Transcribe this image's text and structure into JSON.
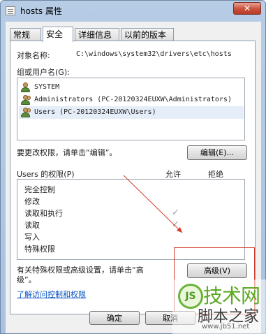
{
  "window": {
    "title": "hosts 属性",
    "close_label": "✕"
  },
  "tabs": [
    {
      "label": "常规",
      "active": false
    },
    {
      "label": "安全",
      "active": true
    },
    {
      "label": "详细信息",
      "active": false
    },
    {
      "label": "以前的版本",
      "active": false
    }
  ],
  "object": {
    "label": "对象名称:",
    "value": "C:\\windows\\system32\\drivers\\etc\\hosts"
  },
  "groups": {
    "label": "组或用户名(G):",
    "items": [
      {
        "name": "SYSTEM",
        "icon": "user-icon",
        "selected": false
      },
      {
        "name": "Administrators (PC-20120324EUXW\\Administrators)",
        "icon": "group-icon",
        "selected": false
      },
      {
        "name": "Users (PC-20120324EUXW\\Users)",
        "icon": "group-icon",
        "selected": true
      }
    ]
  },
  "edit": {
    "hint": "要更改权限，请单击“编辑”。",
    "button_label": "编辑(E)..."
  },
  "permissions": {
    "header": "Users 的权限(P)",
    "allow_label": "允许",
    "deny_label": "拒绝",
    "rows": [
      {
        "name": "完全控制",
        "allow": false,
        "deny": false
      },
      {
        "name": "修改",
        "allow": false,
        "deny": false
      },
      {
        "name": "读取和执行",
        "allow": true,
        "deny": false
      },
      {
        "name": "读取",
        "allow": true,
        "deny": false
      },
      {
        "name": "写入",
        "allow": false,
        "deny": false
      },
      {
        "name": "特殊权限",
        "allow": false,
        "deny": false
      }
    ]
  },
  "advanced": {
    "hint_line1": "有关特殊权限或高级设置，请单击“高",
    "hint_line2": "级”。",
    "button_label": "高级(V)"
  },
  "link": {
    "label": "了解访问控制和权限"
  },
  "footer": {
    "ok_label": "确定",
    "cancel_label": "取消"
  },
  "watermark": {
    "badge": "JS",
    "line1": "技术网",
    "line2": "脚本之家",
    "url": "www.jb51.net"
  },
  "colors": {
    "accent": "#0b55c4",
    "annotation_red": "#d23a2a",
    "checkmark": "#a0a0a0"
  }
}
